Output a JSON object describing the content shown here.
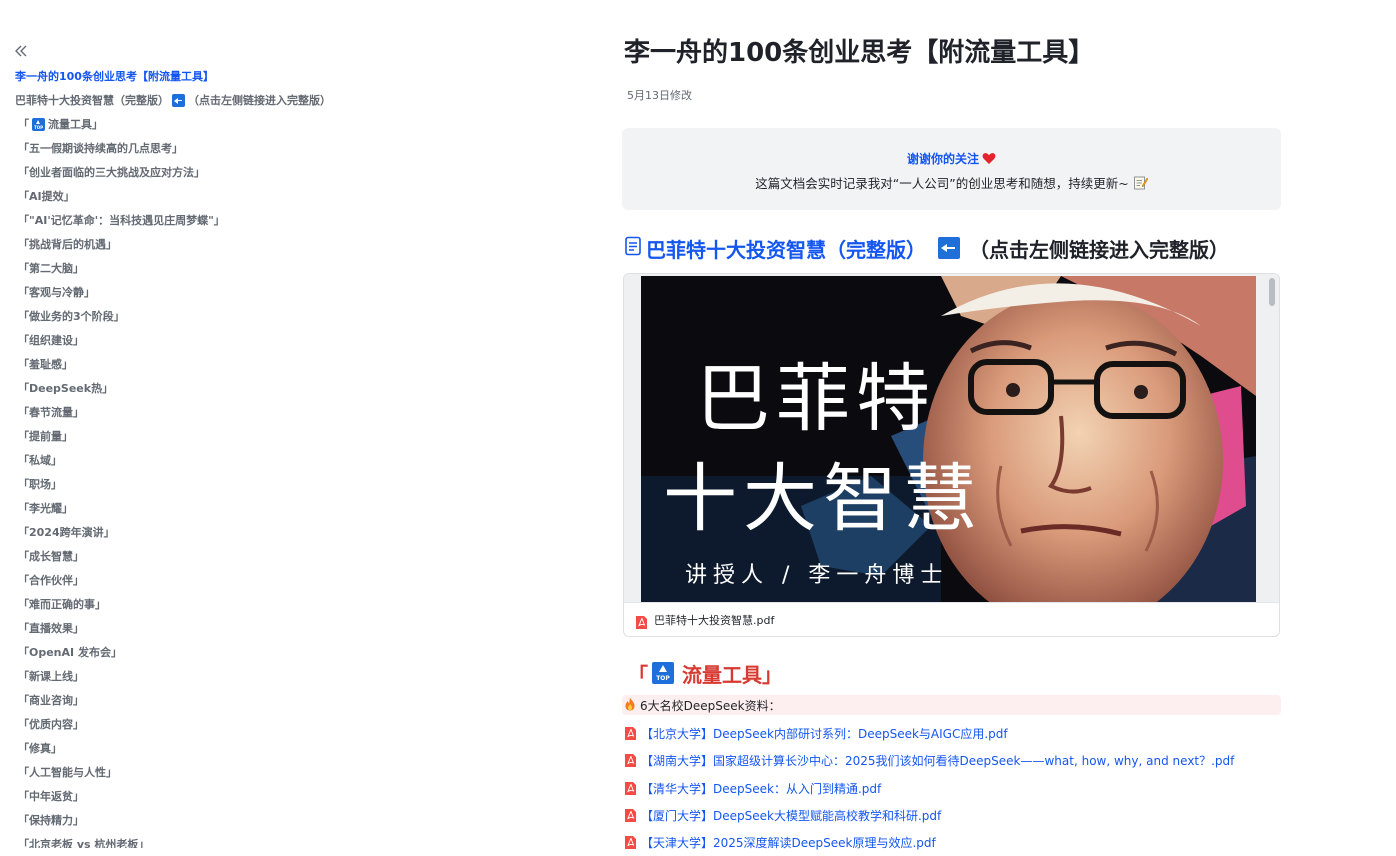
{
  "sidebar": {
    "toc": [
      {
        "label": "李一舟的100条创业思考【附流量工具】",
        "active": true
      },
      {
        "label": "巴菲特十大投资智慧（完整版）",
        "suffix": "（点击左侧链接进入完整版）",
        "icon": "left-arrow-icon"
      },
      {
        "label": "「",
        "suffix": "流量工具」",
        "icon": "top-icon"
      },
      {
        "label": "「五一假期谈持续高的几点思考」"
      },
      {
        "label": "「创业者面临的三大挑战及应对方法」"
      },
      {
        "label": "「AI提效」"
      },
      {
        "label": "「\"AI'记忆革命'：当科技遇见庄周梦蝶\"」"
      },
      {
        "label": "「挑战背后的机遇」"
      },
      {
        "label": "「第二大脑」"
      },
      {
        "label": "「客观与冷静」"
      },
      {
        "label": "「做业务的3个阶段」"
      },
      {
        "label": "「组织建设」"
      },
      {
        "label": "「羞耻感」"
      },
      {
        "label": "「DeepSeek热」"
      },
      {
        "label": "「春节流量」"
      },
      {
        "label": "「提前量」"
      },
      {
        "label": "「私域」"
      },
      {
        "label": "「职场」"
      },
      {
        "label": "「李光耀」"
      },
      {
        "label": "「2024跨年演讲」"
      },
      {
        "label": "「成长智慧」"
      },
      {
        "label": "「合作伙伴」"
      },
      {
        "label": "「难而正确的事」"
      },
      {
        "label": "「直播效果」"
      },
      {
        "label": "「OpenAI 发布会」"
      },
      {
        "label": "「新课上线」"
      },
      {
        "label": "「商业咨询」"
      },
      {
        "label": "「优质内容」"
      },
      {
        "label": "「修真」"
      },
      {
        "label": "「人工智能与人性」"
      },
      {
        "label": "「中年返贫」"
      },
      {
        "label": "「保持精力」"
      },
      {
        "label": "「北京老板 vs 杭州老板」"
      }
    ]
  },
  "main": {
    "title": "李一舟的100条创业思考【附流量工具】",
    "meta": "5月13日修改",
    "callout": {
      "line1": "谢谢你的关注",
      "line2": "这篇文档会实时记录我对“一人公司”的创业思考和随想，持续更新~"
    },
    "heading2": {
      "link": "巴菲特十大投资智慧（完整版）",
      "text": "（点击左侧链接进入完整版）"
    },
    "preview": {
      "title_line1": "巴菲特",
      "title_line2": "十大智慧",
      "subtitle": "讲授人 / 李一舟博士",
      "file_name": "巴菲特十大投资智慧.pdf"
    },
    "heading3": {
      "prefix": "「",
      "text": "流量工具」"
    },
    "highlight": "6大名校DeepSeek资料：",
    "files": [
      "【北京大学】DeepSeek内部研讨系列：DeepSeek与AIGC应用.pdf",
      "【湖南大学】国家超级计算长沙中心：2025我们该如何看待DeepSeek——what, how, why, and next？.pdf",
      "【清华大学】DeepSeek：从入门到精通.pdf",
      "【厦门大学】DeepSeek大模型赋能高校教学和科研.pdf",
      "【天津大学】2025深度解读DeepSeek原理与效应.pdf"
    ]
  },
  "colors": {
    "accent": "#1456f0",
    "heading_red": "#d83931",
    "icon_blue": "#1e6fd9",
    "callout_bg": "#f2f3f5",
    "highlight_bg": "#fdefef"
  }
}
